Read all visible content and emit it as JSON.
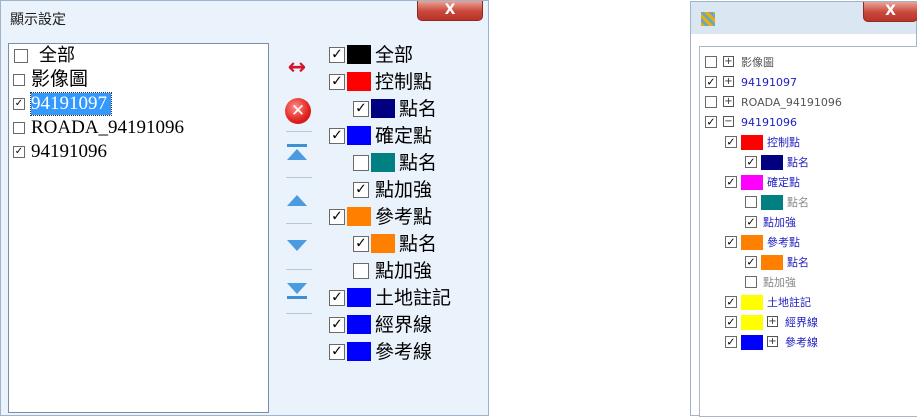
{
  "left_dialog": {
    "title": "顯示設定",
    "close_label": "X",
    "layer_list": {
      "all_label": "全部",
      "all_checked": false,
      "items": [
        {
          "label": "影像圖",
          "checked": false,
          "selected": false
        },
        {
          "label": "94191097",
          "checked": true,
          "selected": true
        },
        {
          "label": "ROADA_94191096",
          "checked": false,
          "selected": false
        },
        {
          "label": "94191096",
          "checked": true,
          "selected": false
        }
      ]
    },
    "buttons": {
      "swap_icon": "swap-arrows-icon",
      "swap_glyph": "↔",
      "delete_icon": "delete-circle-icon",
      "delete_glyph": "✕",
      "move_top_icon": "move-to-top-icon",
      "move_up_icon": "move-up-icon",
      "move_down_icon": "move-down-icon",
      "move_bottom_icon": "move-to-bottom-icon"
    },
    "tree": [
      {
        "label": "全部",
        "checked": true,
        "color": "#000000",
        "level": 0
      },
      {
        "label": "控制點",
        "checked": true,
        "color": "#ff0000",
        "level": 0
      },
      {
        "label": "點名",
        "checked": true,
        "color": "#000080",
        "level": 1
      },
      {
        "label": "確定點",
        "checked": true,
        "color": "#0000ff",
        "level": 0
      },
      {
        "label": "點名",
        "checked": false,
        "color": "#008080",
        "level": 1
      },
      {
        "label": "點加強",
        "checked": true,
        "color": null,
        "level": 1
      },
      {
        "label": "參考點",
        "checked": true,
        "color": "#ff8000",
        "level": 0
      },
      {
        "label": "點名",
        "checked": true,
        "color": "#ff8000",
        "level": 1
      },
      {
        "label": "點加強",
        "checked": false,
        "color": null,
        "level": 1
      },
      {
        "label": "土地註記",
        "checked": true,
        "color": "#0000ff",
        "level": 0
      },
      {
        "label": "經界線",
        "checked": true,
        "color": "#0000ff",
        "level": 0
      },
      {
        "label": "參考線",
        "checked": true,
        "color": "#0000ff",
        "level": 0
      }
    ]
  },
  "right_dialog": {
    "close_label": "X",
    "tree": [
      {
        "label": "影像圖",
        "checked": false,
        "expander": "+",
        "color": null,
        "level": 0,
        "text_color": "#555555"
      },
      {
        "label": "94191097",
        "checked": true,
        "expander": "+",
        "color": null,
        "level": 0,
        "text_color": "#2020c0"
      },
      {
        "label": "ROADA_94191096",
        "checked": false,
        "expander": "+",
        "color": null,
        "level": 0,
        "text_color": "#555555"
      },
      {
        "label": "94191096",
        "checked": true,
        "expander": "−",
        "color": null,
        "level": 0,
        "text_color": "#2020c0"
      },
      {
        "label": "控制點",
        "checked": true,
        "expander": null,
        "color": "#ff0000",
        "level": 1,
        "text_color": "#2020c0"
      },
      {
        "label": "點名",
        "checked": true,
        "expander": null,
        "color": "#000080",
        "level": 2,
        "text_color": "#2020c0"
      },
      {
        "label": "確定點",
        "checked": true,
        "expander": null,
        "color": "#ff00ff",
        "level": 1,
        "text_color": "#2020c0"
      },
      {
        "label": "點名",
        "checked": false,
        "expander": null,
        "color": "#008080",
        "level": 2,
        "text_color": "#888888"
      },
      {
        "label": "點加強",
        "checked": true,
        "expander": null,
        "color": null,
        "level": 2,
        "text_color": "#2020c0"
      },
      {
        "label": "參考點",
        "checked": true,
        "expander": null,
        "color": "#ff8000",
        "level": 1,
        "text_color": "#2020c0"
      },
      {
        "label": "點名",
        "checked": true,
        "expander": null,
        "color": "#ff8000",
        "level": 2,
        "text_color": "#2020c0"
      },
      {
        "label": "點加強",
        "checked": false,
        "expander": null,
        "color": null,
        "level": 2,
        "text_color": "#888888"
      },
      {
        "label": "土地註記",
        "checked": true,
        "expander": null,
        "color": "#ffff00",
        "level": 1,
        "text_color": "#2020c0"
      },
      {
        "label": "經界線",
        "checked": true,
        "expander": "+",
        "color": "#ffff00",
        "level": 1,
        "text_color": "#2020c0"
      },
      {
        "label": "參考線",
        "checked": true,
        "expander": "+",
        "color": "#0000ff",
        "level": 1,
        "text_color": "#2020c0"
      }
    ]
  }
}
